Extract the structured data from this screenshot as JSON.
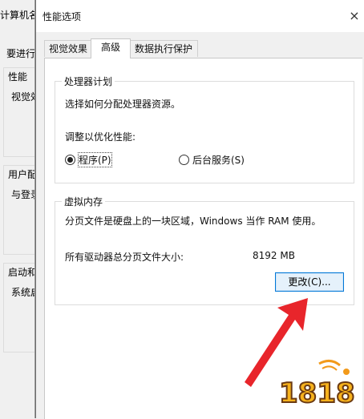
{
  "background_window": {
    "title": "计算机名",
    "left_texts": [
      "要进行",
      "性能",
      "视觉效",
      "用户配",
      "与登录",
      "启动和",
      "系统启"
    ]
  },
  "dialog": {
    "title": "性能选项",
    "close_glyph": "×",
    "tabs": [
      {
        "label": "视觉效果",
        "active": false
      },
      {
        "label": "高级",
        "active": true
      },
      {
        "label": "数据执行保护",
        "active": false
      }
    ],
    "processor_scheduling": {
      "title": "处理器计划",
      "description": "选择如何分配处理器资源。",
      "adjust_label": "调整以优化性能:",
      "options": [
        {
          "label": "程序(P)",
          "selected": true
        },
        {
          "label": "后台服务(S)",
          "selected": false
        }
      ]
    },
    "virtual_memory": {
      "title": "虚拟内存",
      "description": "分页文件是硬盘上的一块区域，Windows 当作 RAM 使用。",
      "total_label": "所有驱动器总分页文件大小:",
      "total_value": "8192 MB",
      "change_button": "更改(C)..."
    }
  },
  "annotation": {
    "arrow_color": "#e8252b"
  },
  "watermark": {
    "text": "1818"
  }
}
